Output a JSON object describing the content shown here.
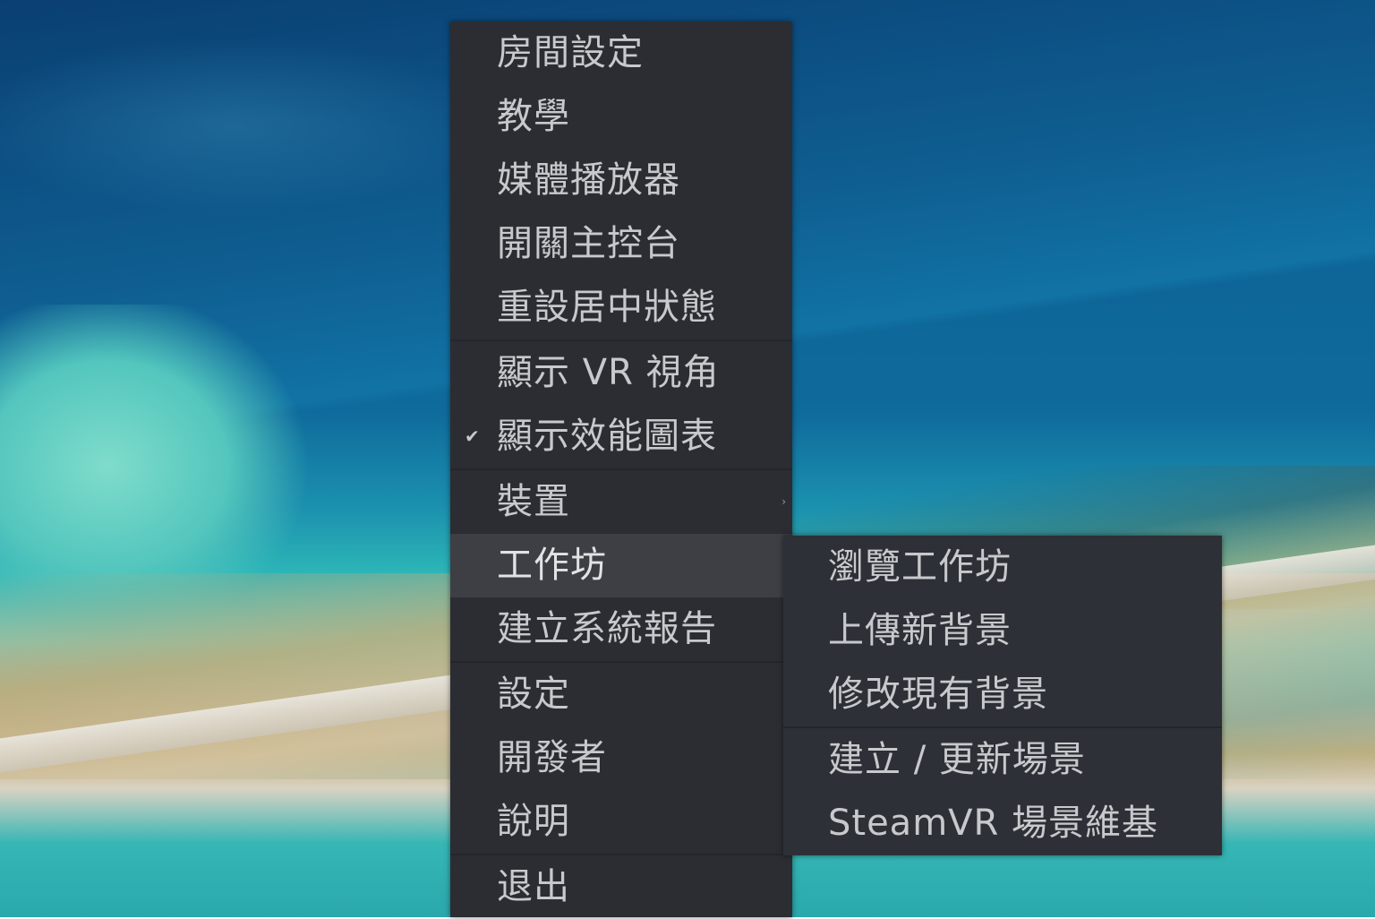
{
  "main_menu": {
    "groups": [
      [
        "房間設定",
        "教學",
        "媒體播放器",
        "開關主控台",
        "重設居中狀態"
      ],
      [
        "顯示 VR 視角",
        "顯示效能圖表"
      ],
      [
        "裝置",
        "工作坊",
        "建立系統報告"
      ],
      [
        "設定",
        "開發者",
        "說明"
      ],
      [
        "退出"
      ]
    ],
    "checked_item": "顯示效能圖表",
    "active_item": "工作坊",
    "submenu_item": "裝置"
  },
  "workshop_submenu": {
    "groups": [
      [
        "瀏覽工作坊",
        "上傳新背景",
        "修改現有背景"
      ],
      [
        "建立 / 更新場景",
        "SteamVR 場景維基"
      ]
    ]
  },
  "icons": {
    "check": "checkmark-icon",
    "submenu_arrow": "chevron-right-icon"
  }
}
